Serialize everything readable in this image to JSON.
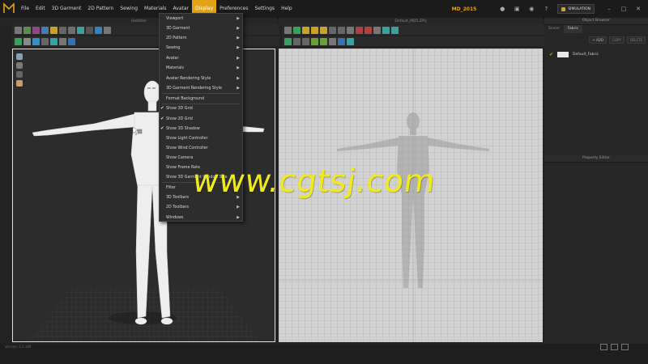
{
  "menubar": {
    "items": [
      "File",
      "Edit",
      "3D Garment",
      "2D Pattern",
      "Sewing",
      "Materials",
      "Avatar",
      "Display",
      "Preferences",
      "Settings",
      "Help"
    ],
    "active_item": "Display",
    "project_name": "MD_2015",
    "simulation_label": "SIMULATION"
  },
  "panels": {
    "viewport3d_title": "Untitled",
    "viewport2d_title": "Default_MD5.ZPrj",
    "object_browser_title": "Object Browser",
    "property_editor_title": "Property Editor"
  },
  "object_browser": {
    "tabs": [
      "Scene",
      "Fabric"
    ],
    "active_tab": "Fabric",
    "actions": [
      "+ ADD",
      "COPY",
      "DELETE"
    ],
    "fabrics": [
      {
        "name": "Default_Fabric",
        "color": "#e8e8e8",
        "applied": true
      }
    ]
  },
  "display_menu": {
    "items": [
      {
        "label": "Viewport",
        "submenu": true,
        "checked": false
      },
      {
        "label": "3D Garment",
        "submenu": true,
        "checked": false
      },
      {
        "label": "2D Pattern",
        "submenu": true,
        "checked": false
      },
      {
        "label": "Sewing",
        "submenu": true,
        "checked": false
      },
      {
        "label": "Avatar",
        "submenu": true,
        "checked": false
      },
      {
        "label": "Materials",
        "submenu": true,
        "checked": false
      },
      {
        "label": "Avatar Rendering Style",
        "submenu": true,
        "checked": false
      },
      {
        "label": "3D Garment Rendering Style",
        "submenu": true,
        "checked": false
      },
      {
        "label": "Format Background",
        "submenu": false,
        "checked": false
      },
      {
        "label": "Show 3D Grid",
        "submenu": false,
        "checked": true
      },
      {
        "label": "Show 2D Grid",
        "submenu": false,
        "checked": true
      },
      {
        "label": "Show 3D Shadow",
        "submenu": false,
        "checked": true
      },
      {
        "label": "Show Light Controller",
        "submenu": false,
        "checked": false
      },
      {
        "label": "Show Wind Controller",
        "submenu": false,
        "checked": false
      },
      {
        "label": "Show Camera",
        "submenu": false,
        "checked": false
      },
      {
        "label": "Show Frame Rate",
        "submenu": false,
        "checked": false
      },
      {
        "label": "Show 3D Garment Window Size",
        "submenu": false,
        "checked": false
      },
      {
        "label": "Filter",
        "submenu": true,
        "checked": false
      },
      {
        "label": "3D Toolbars",
        "submenu": true,
        "checked": false
      },
      {
        "label": "2D Toolbars",
        "submenu": true,
        "checked": false
      },
      {
        "label": "Windows",
        "submenu": true,
        "checked": false
      }
    ]
  },
  "status": {
    "text": "Version: 2.1.189"
  },
  "watermark": "www.cgtsj.com",
  "colors": {
    "accent": "#e3a317",
    "watermark": "#f1ea1a",
    "viewport3d_bg": "#2c2c2c",
    "viewport2d_bg": "#d2d2d2",
    "avatar": "#eeeeee"
  }
}
